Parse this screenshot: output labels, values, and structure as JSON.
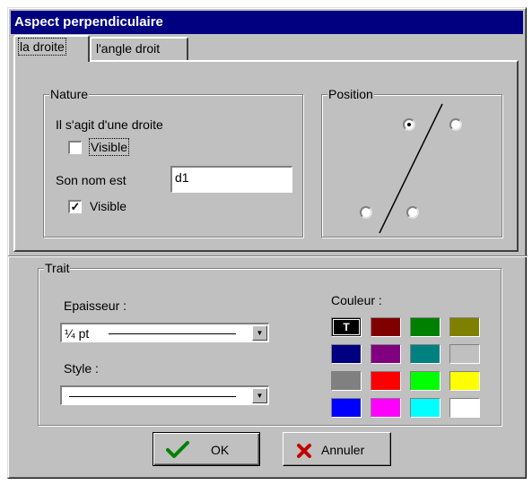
{
  "window": {
    "title": "Aspect perpendiculaire"
  },
  "tabs": [
    {
      "label": "la droite",
      "active": true
    },
    {
      "label": "l'angle droit",
      "active": false
    }
  ],
  "nature": {
    "title": "Nature",
    "statement": "Il s'agit d'une droite",
    "visible1": {
      "label": "Visible",
      "checked": false
    },
    "name_label": "Son nom est",
    "name_value": "d1",
    "visible2": {
      "label": "Visible",
      "checked": true
    }
  },
  "position": {
    "title": "Position",
    "options": [
      {
        "id": "top-left",
        "selected": true
      },
      {
        "id": "top-right",
        "selected": false
      },
      {
        "id": "bottom-left",
        "selected": false
      },
      {
        "id": "bottom-right",
        "selected": false
      }
    ]
  },
  "trait": {
    "title": "Trait",
    "epaisseur_label": "Epaisseur :",
    "epaisseur_value": "¼ pt",
    "style_label": "Style :",
    "style_value": "solid",
    "couleur_label": "Couleur :",
    "swatch_selected_glyph": "T",
    "colors": [
      "#000000",
      "#800000",
      "#008000",
      "#808000",
      "#000080",
      "#800080",
      "#008080",
      "#c0c0c0",
      "#808080",
      "#ff0000",
      "#00ff00",
      "#ffff00",
      "#0000ff",
      "#ff00ff",
      "#00ffff",
      "#ffffff"
    ],
    "selected_color_index": 0
  },
  "buttons": {
    "ok_label": "OK",
    "cancel_label": "Annuler",
    "ok_icon": "checkmark-icon",
    "cancel_icon": "x-icon"
  }
}
